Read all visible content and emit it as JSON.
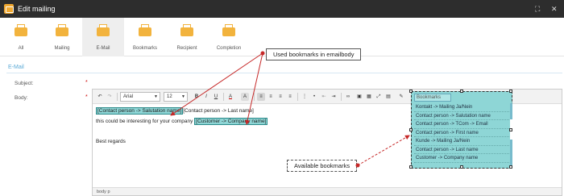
{
  "window": {
    "title": "Edit mailing",
    "fullscreen_icon": "fullscreen-icon",
    "close_icon": "close-icon"
  },
  "tabs": [
    {
      "label": "All",
      "icon": "envelope-icon",
      "active": false
    },
    {
      "label": "Mailing",
      "icon": "envelope-icon",
      "active": false
    },
    {
      "label": "E-Mail",
      "icon": "envelope-icon",
      "active": true
    },
    {
      "label": "Bookmarks",
      "icon": "envelope-icon",
      "active": false
    },
    {
      "label": "Recipient",
      "icon": "envelope-icon",
      "active": false
    },
    {
      "label": "Completion",
      "icon": "envelope-icon",
      "active": false
    }
  ],
  "section": {
    "title": "E-Mail"
  },
  "form": {
    "subject_label": "Subject:",
    "body_label": "Body:",
    "required_mark": "*",
    "subject_value": ""
  },
  "toolbar": {
    "font": "Arial",
    "size": "12",
    "bold": "B",
    "italic": "I",
    "underline": "U",
    "font_color": "A",
    "bg_color": "A",
    "bookmarks_select": "Bookmarks"
  },
  "editor": {
    "line1_bookmark": "[Contact person -> Salutation name]",
    "line1_rest": "[Contact person -> Last name]",
    "line2_text": "this could be interesting for your company",
    "line2_bookmark": "[Customer -> Company name]",
    "line3_text": "Best regards",
    "status_path": "body  p"
  },
  "bookmark_list": [
    "Kontakt -> Mailing Ja/Nein",
    "Contact person -> Salutation name",
    "Contact person -> TCom -> Email",
    "Contact person -> First name",
    "Kunde -> Mailing Ja/Nein",
    "Contact person -> Last name",
    "Customer -> Company name"
  ],
  "annotations": {
    "used": "Used bookmarks in emailbody",
    "available": "Available bookmarks"
  },
  "colors": {
    "accent": "#5aa9d6",
    "bookmark_bg": "#8ed6d6",
    "arrow": "#c62828",
    "titlebar": "#2d2d2d"
  }
}
